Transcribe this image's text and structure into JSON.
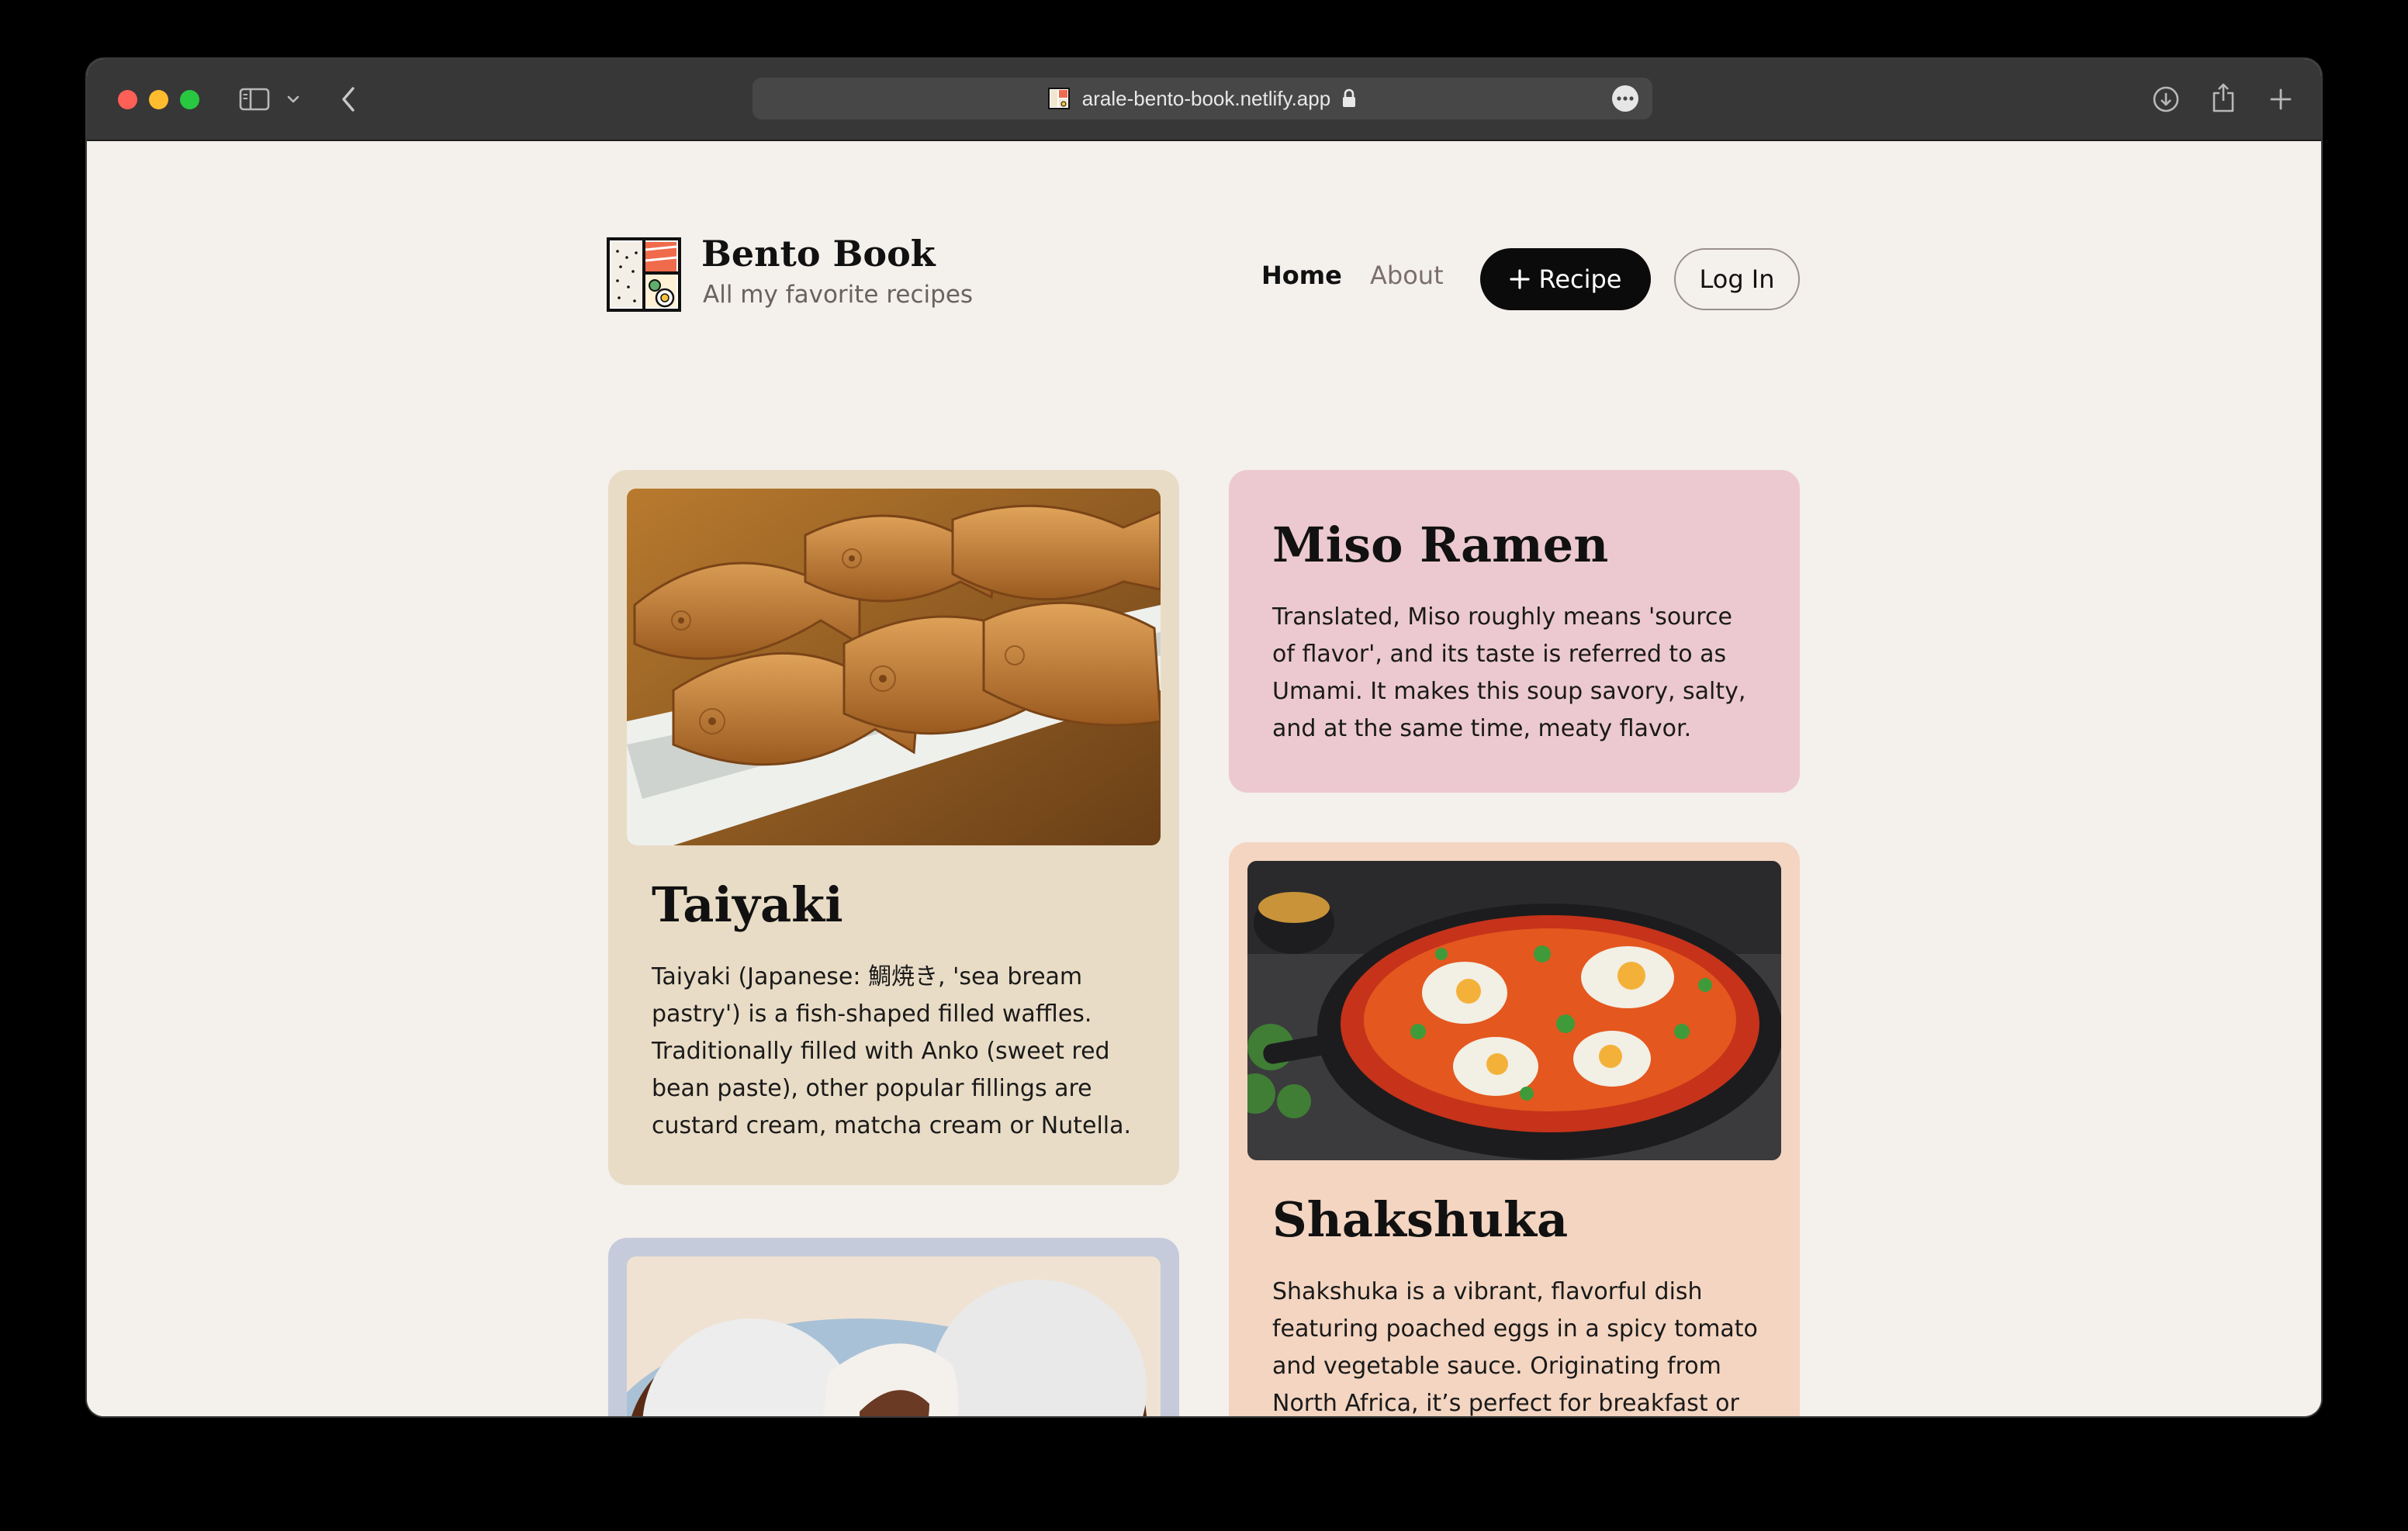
{
  "browser": {
    "url": "arale-bento-book.netlify.app"
  },
  "site": {
    "title": "Bento Book",
    "subtitle": "All my favorite recipes"
  },
  "nav": {
    "home": "Home",
    "about": "About",
    "recipe_button": "Recipe",
    "login_button": "Log In"
  },
  "recipes": [
    {
      "title": "Taiyaki",
      "description": "Taiyaki (Japanese: 鯛焼き, 'sea bream pastry') is a fish-shaped filled waffles. Traditionally filled with Anko (sweet red bean paste), other popular fillings are custard cream, matcha cream or Nutella.",
      "card_color": "#e9dcc6"
    },
    {
      "title": "Miso Ramen",
      "description": "Translated, Miso roughly means 'source of flavor', and its taste is referred to as Umami. It makes this soup savory, salty, and at the same time, meaty flavor.",
      "card_color": "#ecc9d0"
    },
    {
      "title": "Shakshuka",
      "description": "Shakshuka is a vibrant, flavorful dish featuring poached eggs in a spicy tomato and vegetable sauce. Originating from North Africa, it’s perfect for breakfast or brunch. Enjoy it with fresh coriander and crusty bread.",
      "card_color": "#f3d5c1"
    },
    {
      "title": "",
      "description": "",
      "card_color": "#c5cbdb"
    }
  ]
}
